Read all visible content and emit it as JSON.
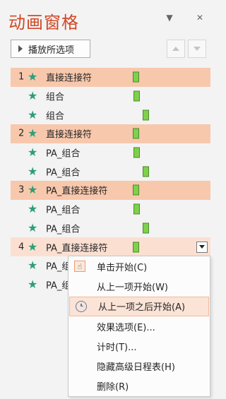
{
  "title": "动画窗格",
  "header": {
    "dropdown_icon": "▼",
    "close_icon": "✕"
  },
  "toolbar": {
    "play_label": "播放所选项"
  },
  "rows": [
    {
      "num": "1",
      "label": "直接连接符"
    },
    {
      "num": "",
      "label": "组合"
    },
    {
      "num": "",
      "label": "组合"
    },
    {
      "num": "2",
      "label": "直接连接符"
    },
    {
      "num": "",
      "label": "PA_组合"
    },
    {
      "num": "",
      "label": "PA_组合"
    },
    {
      "num": "3",
      "label": "PA_直接连接符"
    },
    {
      "num": "",
      "label": "PA_组合"
    },
    {
      "num": "",
      "label": "PA_组合"
    },
    {
      "num": "4",
      "label": "PA_直接连接符"
    },
    {
      "num": "",
      "label": "PA_组合"
    },
    {
      "num": "",
      "label": "PA_组合"
    }
  ],
  "menu": [
    {
      "label": "单击开始(C)"
    },
    {
      "label": "从上一项开始(W)"
    },
    {
      "label": "从上一项之后开始(A)"
    },
    {
      "label": "效果选项(E)..."
    },
    {
      "label": "计时(T)..."
    },
    {
      "label": "隐藏高级日程表(H)"
    },
    {
      "label": "删除(R)"
    }
  ],
  "colors": {
    "title": "#d24726",
    "group_row": "#f8c8ad",
    "star": "#2e9e78",
    "bar": "#7fd04c"
  }
}
